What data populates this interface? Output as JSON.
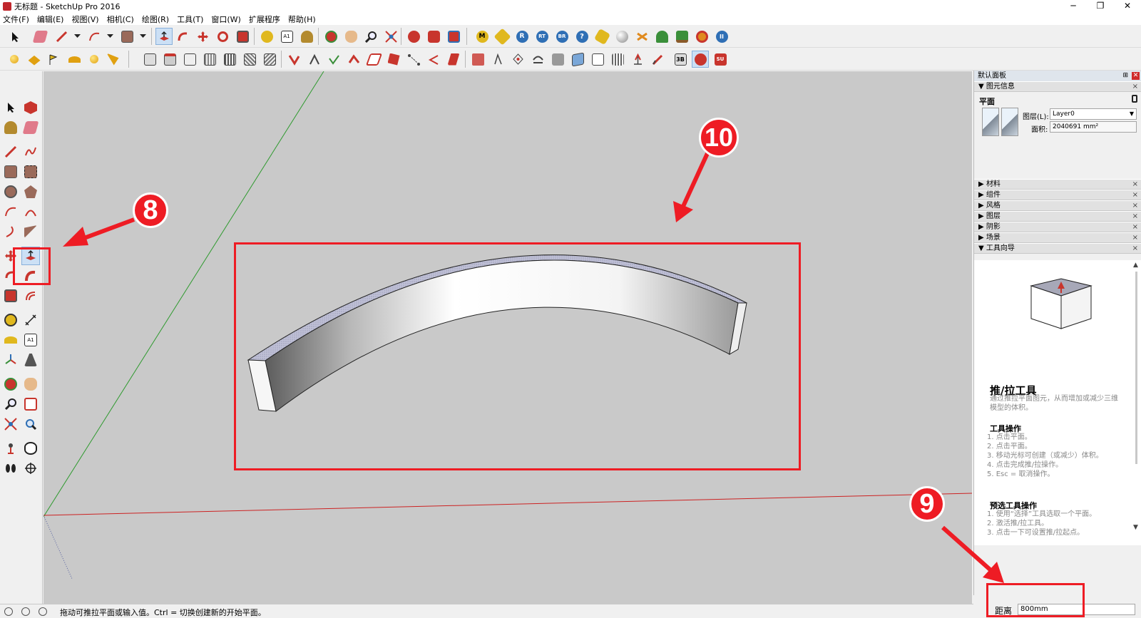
{
  "window": {
    "title": "无标题 - SketchUp Pro 2016",
    "minimize": "─",
    "restore": "❐",
    "close": "✕"
  },
  "menu": [
    "文件(F)",
    "编辑(E)",
    "视图(V)",
    "相机(C)",
    "绘图(R)",
    "工具(T)",
    "窗口(W)",
    "扩展程序",
    "帮助(H)"
  ],
  "toolbar_colors": {
    "accent_red": "#c8352d",
    "accent_orange": "#e08a1e",
    "accent_blue": "#2f6fb5",
    "accent_green": "#3a8f3a",
    "accent_gray": "#777777"
  },
  "right_panel": {
    "title": "默认面板",
    "pin": "⊞",
    "close": "✕",
    "entity_info": {
      "header": "图元信息",
      "kind": "平面",
      "layer_label": "图层(L):",
      "layer_value": "Layer0",
      "area_label": "面积:",
      "area_value": "2040691 mm²"
    },
    "sections": [
      "材料",
      "组件",
      "风格",
      "图层",
      "阴影",
      "场景"
    ],
    "instructor": {
      "header": "工具向导",
      "title": "推/拉工具",
      "description": "通过推拉平面图元，从而增加或减少三维模型的体积。",
      "ops_heading": "工具操作",
      "ops": [
        "1.  点击平面。",
        "2.  点击平面。",
        "3.  移动光标可创建（或减少）体积。",
        "4.  点击完成推/拉操作。",
        "5.  Esc = 取消操作。"
      ],
      "pre_heading": "预选工具操作",
      "pre_ops": [
        "1.  使用“选择”工具选取一个平面。",
        "2.  激活推/拉工具。",
        "3.  点击一下可设置推/拉起点。"
      ]
    }
  },
  "vcb": {
    "label": "距离",
    "value": "800mm"
  },
  "status": {
    "text": "拖动可推拉平面或输入值。Ctrl = 切换创建新的开始平面。"
  },
  "annotations": {
    "num_8": "8",
    "num_9": "9",
    "num_10": "10",
    "color": "#ee1c24"
  }
}
